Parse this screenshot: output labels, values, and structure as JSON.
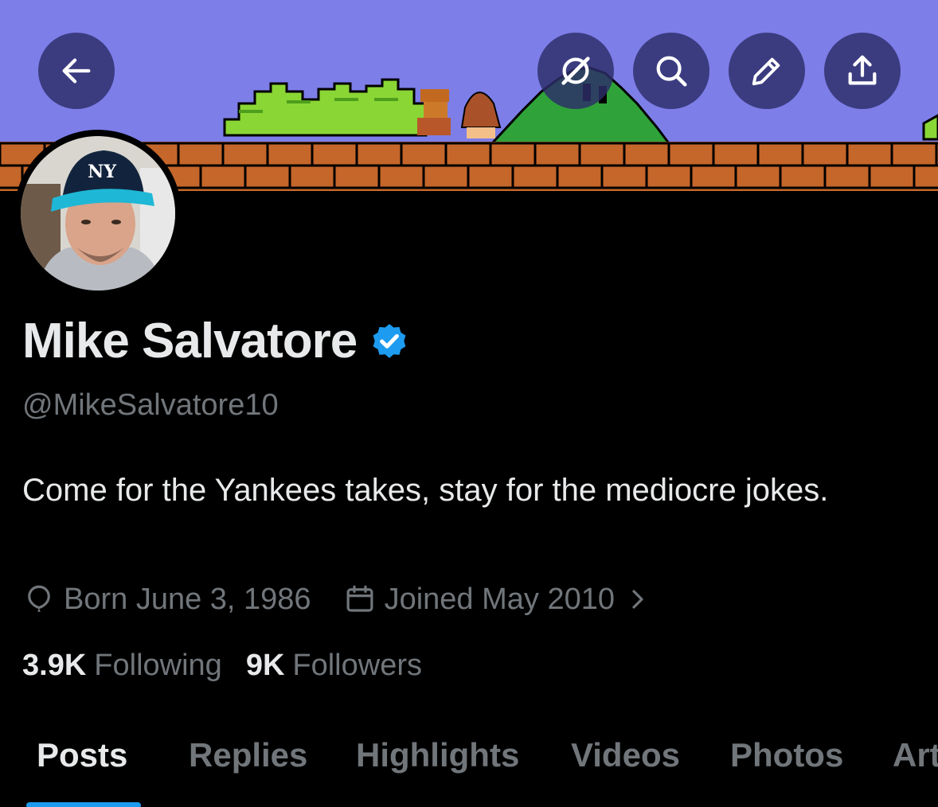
{
  "header": {
    "back_icon": "arrow-left-icon",
    "buttons": [
      {
        "icon": "grok-icon"
      },
      {
        "icon": "search-icon"
      },
      {
        "icon": "pencil-icon"
      },
      {
        "icon": "share-icon"
      }
    ]
  },
  "profile": {
    "name": "Mike Salvatore",
    "verified": true,
    "handle": "@MikeSalvatore10",
    "bio": "Come for the Yankees takes, stay for the mediocre jokes.",
    "born": "Born June 3, 1986",
    "joined": "Joined May 2010",
    "following_count": "3.9K",
    "following_label": "Following",
    "followers_count": "9K",
    "followers_label": "Followers"
  },
  "tabs": {
    "posts": "Posts",
    "replies": "Replies",
    "highlights": "Highlights",
    "videos": "Videos",
    "photos": "Photos",
    "articles": "Art",
    "active": "Posts"
  },
  "colors": {
    "accent": "#1d9bf0",
    "background": "#000000",
    "muted": "#71767b",
    "sky": "#7d7ee8"
  }
}
